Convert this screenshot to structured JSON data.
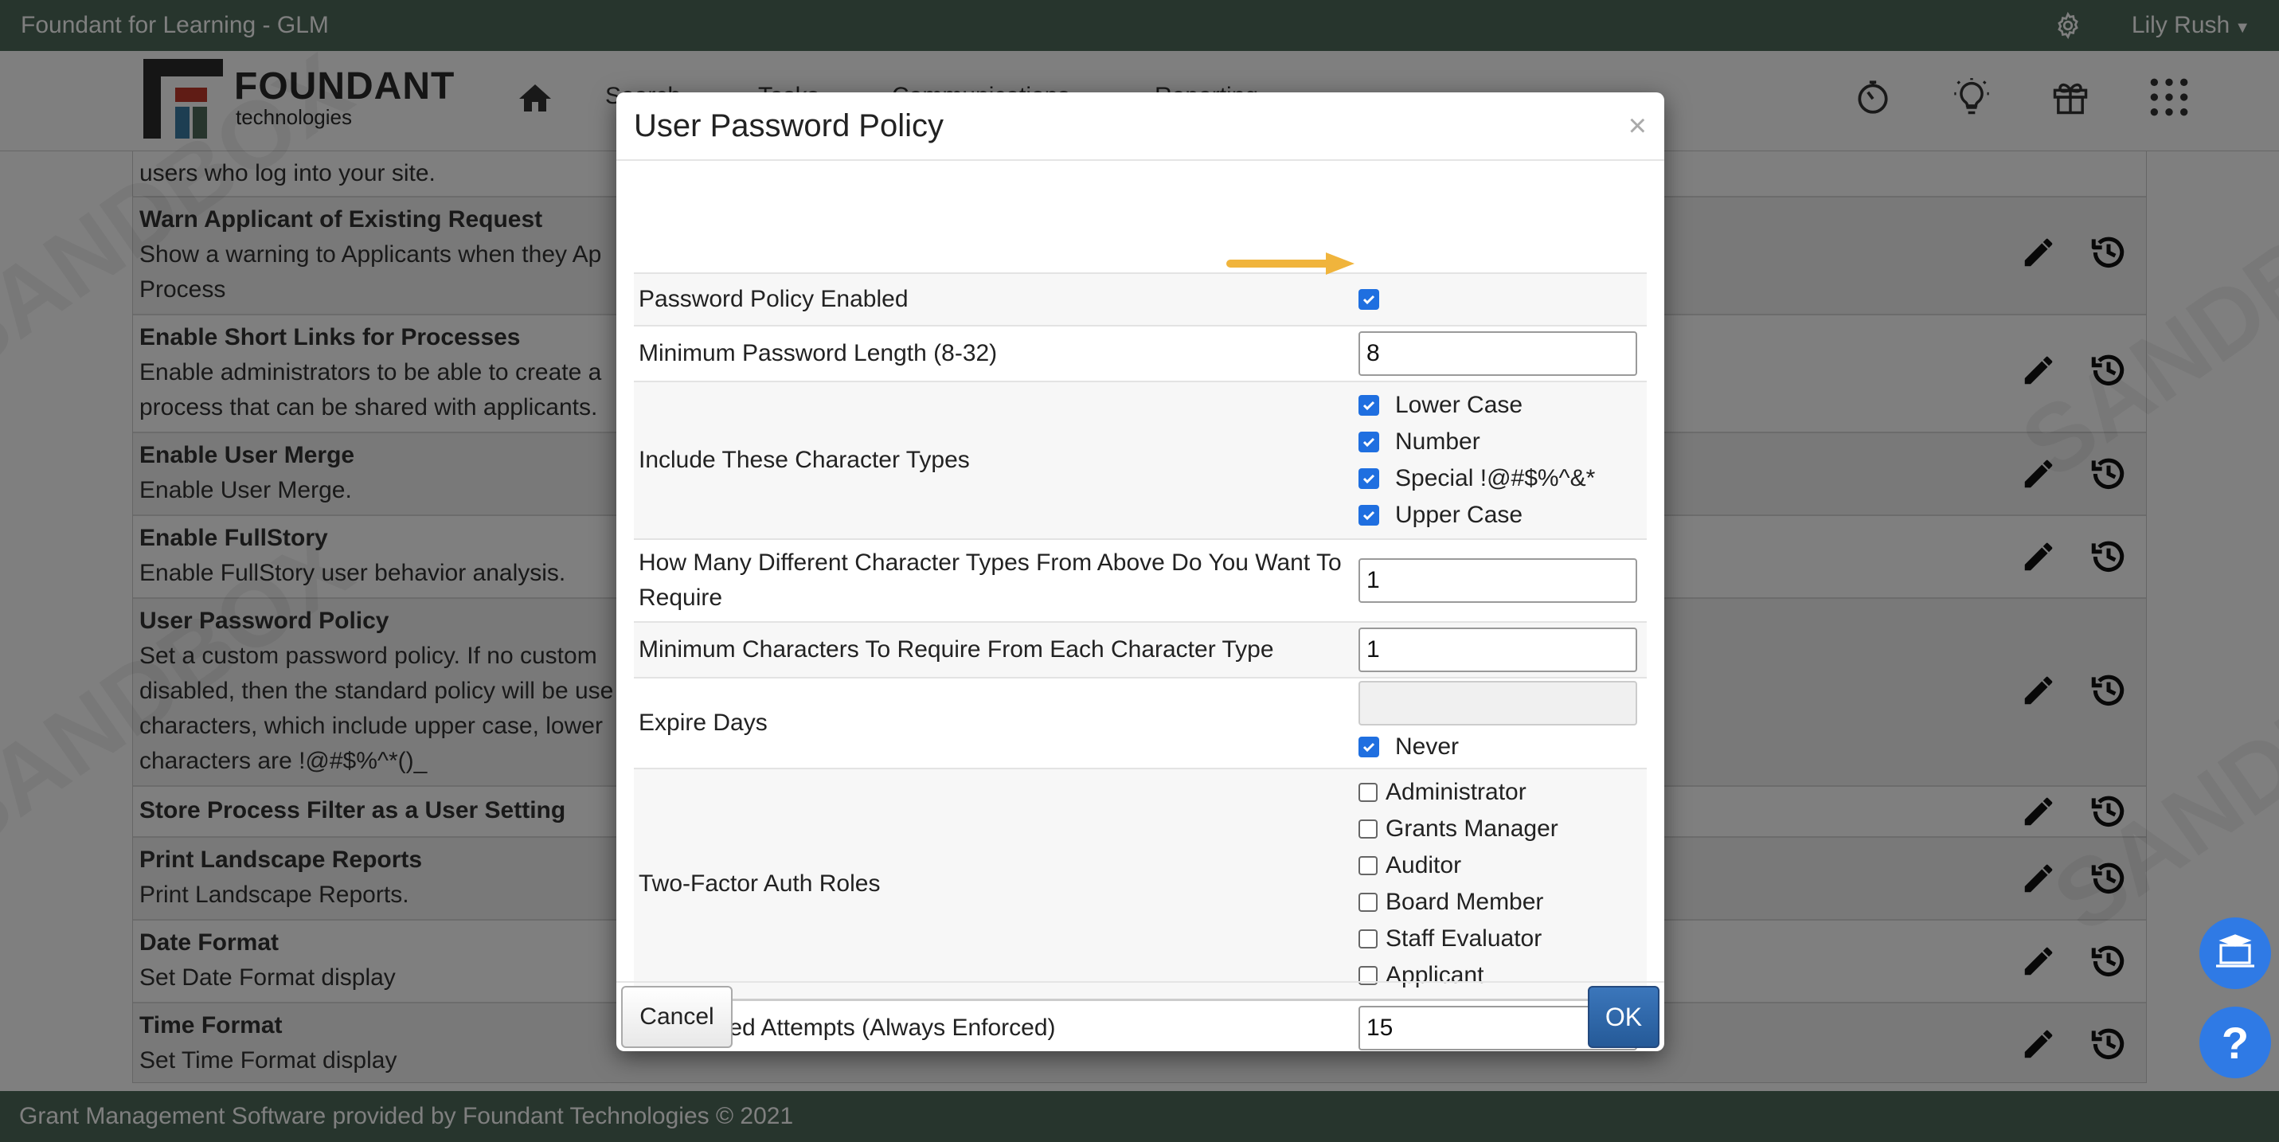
{
  "window": {
    "title": "Foundant for Learning - GLM",
    "user": "Lily Rush"
  },
  "nav": {
    "items": [
      "Search",
      "Tasks",
      "Communications",
      "Reporting"
    ]
  },
  "logo": {
    "word1": "FOUNDANT",
    "word2": "technologies"
  },
  "watermark": "SANDBOX",
  "settings": {
    "rows": [
      {
        "title": "",
        "desc": "users who log into your site."
      },
      {
        "title": "Warn Applicant of Existing Request",
        "desc": "Show a warning to Applicants when they Ap",
        "desc2": "Process"
      },
      {
        "title": "Enable Short Links for Processes",
        "desc": "Enable administrators to be able to create a",
        "desc2": "process that can be shared with applicants."
      },
      {
        "title": "Enable User Merge",
        "desc": "Enable User Merge."
      },
      {
        "title": "Enable FullStory",
        "desc": "Enable FullStory user behavior analysis."
      },
      {
        "title": "User Password Policy",
        "desc": "Set a custom password policy. If no custom",
        "desc2": "disabled, then the standard policy will be use",
        "desc3": "characters, which include upper case, lower",
        "desc4": "characters are !@#$%^*()_"
      },
      {
        "title": "Store Process Filter as a User Setting",
        "desc": ""
      },
      {
        "title": "Print Landscape Reports",
        "desc": "Print Landscape Reports."
      },
      {
        "title": "Date Format",
        "desc": "Set Date Format display"
      },
      {
        "title": "Time Format",
        "desc": "Set Time Format display"
      }
    ]
  },
  "footer": {
    "text": "Grant Management Software provided by Foundant Technologies © 2021"
  },
  "modal": {
    "title": "User Password Policy",
    "close": "×",
    "policy_enabled_label": "Password Policy Enabled",
    "policy_enabled": true,
    "min_length_label": "Minimum Password Length (8-32)",
    "min_length": "8",
    "char_types_label": "Include These Character Types",
    "char_types": [
      {
        "label": "Lower Case",
        "checked": true
      },
      {
        "label": "Number",
        "checked": true
      },
      {
        "label": "Special !@#$%^&*",
        "checked": true
      },
      {
        "label": "Upper Case",
        "checked": true
      }
    ],
    "require_types_label": "How Many Different Character Types From Above Do You Want To Require",
    "require_types": "1",
    "min_each_label": "Minimum Characters To Require From Each Character Type",
    "min_each": "1",
    "expire_label": "Expire Days",
    "expire_days": "",
    "never_label": "Never",
    "never": true,
    "two_factor_label": "Two-Factor Auth Roles",
    "roles": [
      {
        "label": "Administrator",
        "checked": false
      },
      {
        "label": "Grants Manager",
        "checked": false
      },
      {
        "label": "Auditor",
        "checked": false
      },
      {
        "label": "Board Member",
        "checked": false
      },
      {
        "label": "Staff Evaluator",
        "checked": false
      },
      {
        "label": "Applicant",
        "checked": false
      }
    ],
    "max_failed_label": "Max Failed Attempts (Always Enforced)",
    "max_failed": "15",
    "cancel": "Cancel",
    "ok": "OK"
  },
  "colors": {
    "topbar": "#4e6b5a",
    "accent": "#1f6fe0",
    "ok_button": "#2f66a8",
    "arrow": "#f0b43c",
    "fab": "#2f7ae5"
  }
}
